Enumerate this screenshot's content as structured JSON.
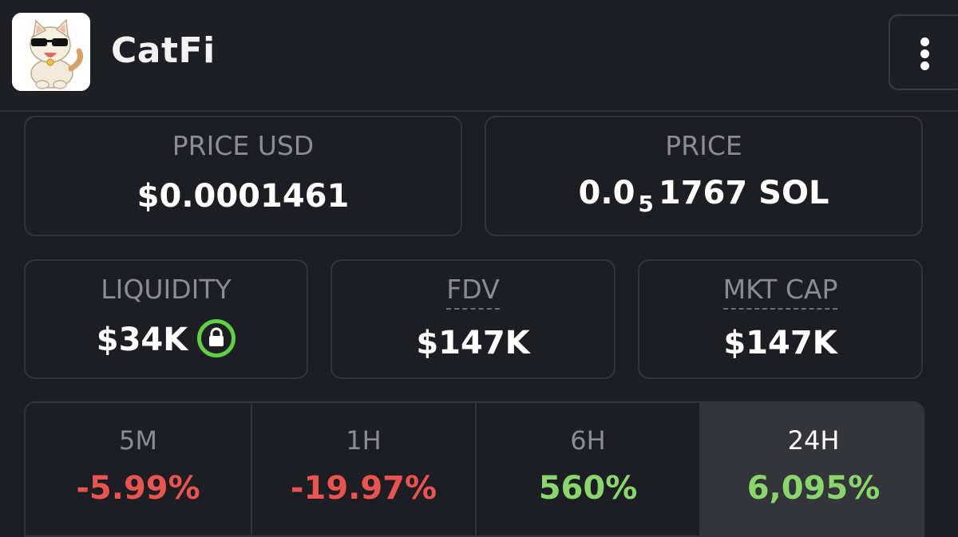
{
  "header": {
    "title": "CatFi",
    "logo_icon": "cat-sunglasses-logo",
    "menu_icon": "more-vertical-icon"
  },
  "price_usd": {
    "label": "PRICE USD",
    "value": "$0.0001461"
  },
  "price_sol": {
    "label": "PRICE",
    "prefix": "0.0",
    "zero_count": "5",
    "suffix": "1767 SOL"
  },
  "liquidity": {
    "label": "LIQUIDITY",
    "value": "$34K",
    "lock_icon": "lock-icon",
    "lock_color": "#5fcf44"
  },
  "fdv": {
    "label": "FDV",
    "value": "$147K"
  },
  "mkt_cap": {
    "label": "MKT CAP",
    "value": "$147K"
  },
  "timeframes": [
    {
      "label": "5M",
      "change": "-5.99%",
      "color": "#e9544f",
      "active": false
    },
    {
      "label": "1H",
      "change": "-19.97%",
      "color": "#e9544f",
      "active": false
    },
    {
      "label": "6H",
      "change": "560%",
      "color": "#89d66a",
      "active": false
    },
    {
      "label": "24H",
      "change": "6,095%",
      "color": "#89d66a",
      "active": true
    }
  ],
  "colors": {
    "background": "#1d1e23",
    "card_border": "#34353a",
    "negative": "#e9544f",
    "positive": "#89d66a"
  }
}
